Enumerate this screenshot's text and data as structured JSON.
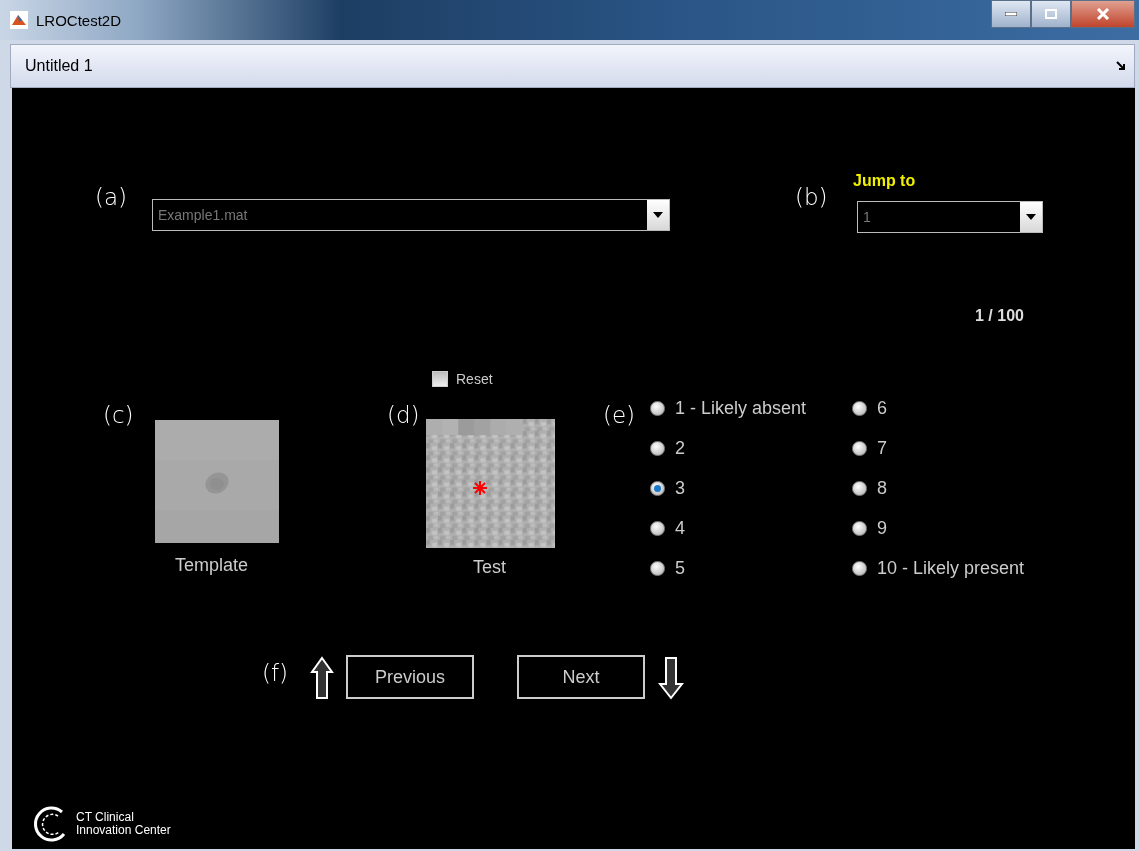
{
  "window": {
    "title": "LROCtest2D"
  },
  "tab": {
    "label": "Untitled 1"
  },
  "file_select": {
    "marker": "(a)",
    "value": "Example1.mat"
  },
  "jump_to": {
    "marker": "(b)",
    "label": "Jump to",
    "value": "1"
  },
  "counter": "1 / 100",
  "reset": {
    "label": "Reset",
    "checked": false
  },
  "template": {
    "marker": "(c)",
    "caption": "Template"
  },
  "test": {
    "marker": "(d)",
    "caption": "Test"
  },
  "rating": {
    "marker": "(e)",
    "options": [
      {
        "label": "1 - Likely absent",
        "selected": false
      },
      {
        "label": "2",
        "selected": false
      },
      {
        "label": "3",
        "selected": true
      },
      {
        "label": "4",
        "selected": false
      },
      {
        "label": "5",
        "selected": false
      },
      {
        "label": "6",
        "selected": false
      },
      {
        "label": "7",
        "selected": false
      },
      {
        "label": "8",
        "selected": false
      },
      {
        "label": "9",
        "selected": false
      },
      {
        "label": "10 - Likely present",
        "selected": false
      }
    ]
  },
  "navigation": {
    "marker": "(f)",
    "buttons": [
      "Previous",
      "Next"
    ]
  },
  "logo": {
    "lines": [
      "CT Clinical",
      "Innovation Center"
    ]
  }
}
